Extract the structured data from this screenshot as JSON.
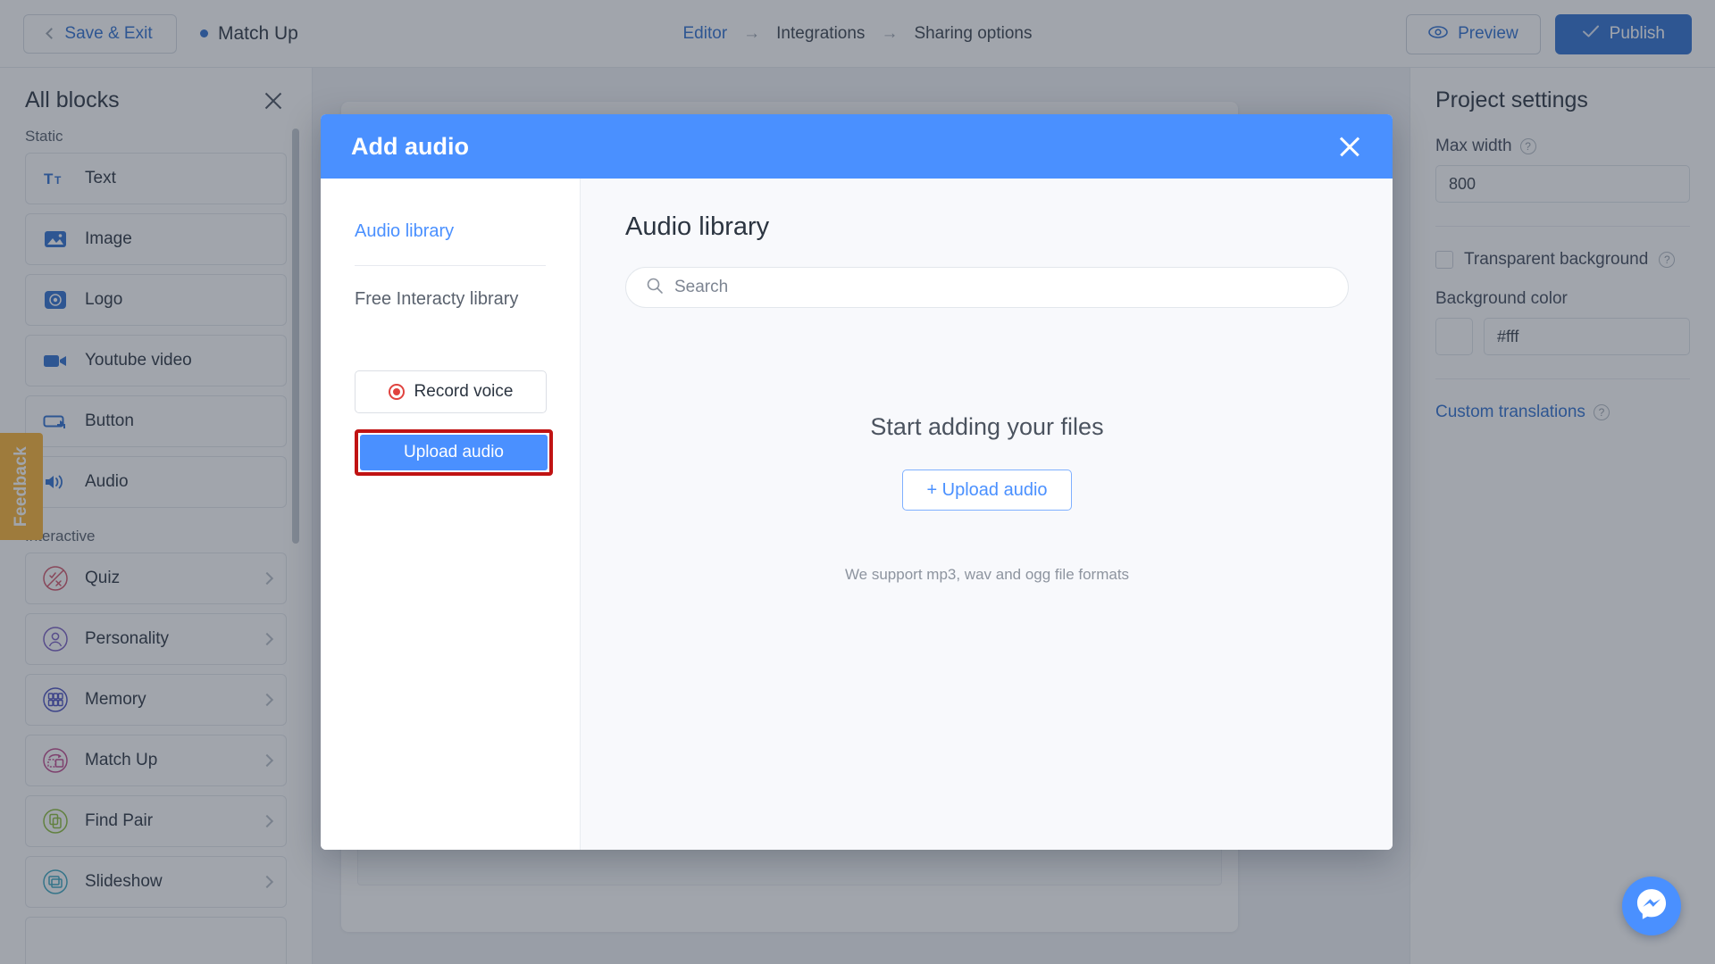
{
  "topbar": {
    "save_exit_label": "Save & Exit",
    "project_name": "Match Up",
    "breadcrumbs": [
      {
        "label": "Editor",
        "active": true
      },
      {
        "label": "Integrations",
        "active": false
      },
      {
        "label": "Sharing options",
        "active": false
      }
    ],
    "arrow_glyph": "→",
    "preview_label": "Preview",
    "publish_label": "Publish",
    "publish_color": "#2f6fd0"
  },
  "left_panel": {
    "title": "All blocks",
    "close_icon": "close-icon",
    "sections": [
      {
        "label": "Static"
      },
      {
        "label": "Interactive"
      }
    ],
    "static_blocks": [
      {
        "label": "Text",
        "icon": "text-icon",
        "color": "#2f6fd0"
      },
      {
        "label": "Image",
        "icon": "image-icon",
        "color": "#2f6fd0"
      },
      {
        "label": "Logo",
        "icon": "logo-icon",
        "color": "#2f6fd0"
      },
      {
        "label": "Youtube video",
        "icon": "video-icon",
        "color": "#2f6fd0"
      },
      {
        "label": "Button",
        "icon": "button-icon",
        "color": "#2f6fd0"
      },
      {
        "label": "Audio",
        "icon": "audio-icon",
        "color": "#2f6fd0"
      }
    ],
    "interactive_blocks": [
      {
        "label": "Quiz",
        "icon": "quiz-icon",
        "color": "#d1556a"
      },
      {
        "label": "Personality",
        "icon": "personality-icon",
        "color": "#7a5fc4"
      },
      {
        "label": "Memory",
        "icon": "memory-icon",
        "color": "#4a4fc0"
      },
      {
        "label": "Match Up",
        "icon": "matchup-icon",
        "color": "#c04a8f"
      },
      {
        "label": "Find Pair",
        "icon": "findpair-icon",
        "color": "#8bbd3a"
      },
      {
        "label": "Slideshow",
        "icon": "slideshow-icon",
        "color": "#3aa6c0"
      }
    ],
    "feedback_label": "Feedback",
    "feedback_color": "#f9b233"
  },
  "right_panel": {
    "title": "Project settings",
    "max_width_label": "Max width",
    "max_width_value": "800",
    "transparent_bg_label": "Transparent background",
    "transparent_bg_checked": false,
    "background_color_label": "Background color",
    "background_color_value": "#fff",
    "custom_translations_label": "Custom translations",
    "help_glyph": "?"
  },
  "modal": {
    "title": "Add audio",
    "header_color": "#4a90ff",
    "close_icon": "close-icon",
    "side": {
      "tabs": [
        {
          "label": "Audio library",
          "active": true
        },
        {
          "label": "Free Interacty library",
          "active": false
        }
      ],
      "record_label": "Record voice",
      "record_icon": "record-dot-icon",
      "upload_label": "Upload audio",
      "upload_highlight_color": "#c01313"
    },
    "main": {
      "heading": "Audio library",
      "search_placeholder": "Search",
      "search_value": "",
      "search_icon": "search-icon",
      "empty_title": "Start adding your files",
      "empty_upload_label": "+ Upload audio",
      "empty_note": "We support mp3, wav and ogg file formats"
    }
  },
  "fab": {
    "name": "messenger-chat-button",
    "color": "#4a90ff"
  }
}
